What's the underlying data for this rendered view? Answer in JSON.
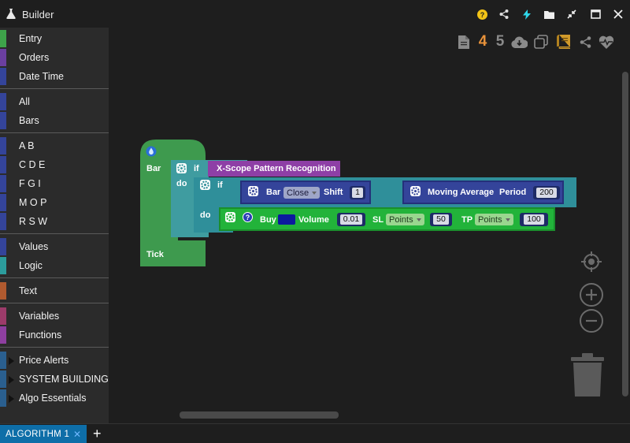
{
  "window": {
    "title": "Builder",
    "icons": [
      "help-icon",
      "share-icon",
      "bolt-icon",
      "folder-icon",
      "collapse-icon",
      "maximize-icon",
      "close-icon"
    ]
  },
  "sidebar": {
    "groups": [
      [
        {
          "label": "Entry",
          "color": "#3ea34a"
        },
        {
          "label": "Orders",
          "color": "#6b3fa0"
        },
        {
          "label": "Date Time",
          "color": "#34449a"
        }
      ],
      [
        {
          "label": "All",
          "color": "#34449a"
        },
        {
          "label": "Bars",
          "color": "#34449a"
        }
      ],
      [
        {
          "label": "A B",
          "color": "#34449a"
        },
        {
          "label": "C D E",
          "color": "#34449a"
        },
        {
          "label": "F G I",
          "color": "#34449a"
        },
        {
          "label": "M O P",
          "color": "#34449a"
        },
        {
          "label": "R S W",
          "color": "#34449a"
        }
      ],
      [
        {
          "label": "Values",
          "color": "#34449a"
        },
        {
          "label": "Logic",
          "color": "#2c9c9c"
        }
      ],
      [
        {
          "label": "Text",
          "color": "#b05a2f"
        }
      ],
      [
        {
          "label": "Variables",
          "color": "#9c3b6a"
        },
        {
          "label": "Functions",
          "color": "#8e3fa0"
        }
      ],
      [
        {
          "label": "Price Alerts",
          "color": "#2a5f8f",
          "arrow": true
        },
        {
          "label": "SYSTEM BUILDING",
          "color": "#2a5f8f",
          "arrow": true
        },
        {
          "label": "Algo Essentials",
          "color": "#2a5f8f",
          "arrow": true
        }
      ]
    ]
  },
  "toolbar": {
    "undo_count": "4",
    "redo_count": "5",
    "icons": [
      "document-icon",
      "download-cloud-icon",
      "copy-icon",
      "book-icon",
      "share-icon",
      "heartbeat-icon"
    ]
  },
  "blocks": {
    "entry": {
      "bar_label": "Bar",
      "do_label": "do",
      "tick_label": "Tick",
      "color": "#3e9a4e"
    },
    "outer_if": {
      "if_label": "if",
      "do_label": "do",
      "color": "#3f9ca0"
    },
    "pattern": {
      "label": "X-Scope Pattern Recognition",
      "color": "#8e3fa6"
    },
    "inner_if": {
      "if_label": "if",
      "do_label": "do",
      "color": "#2f8f9a"
    },
    "bar_value": {
      "label": "Bar",
      "field": "Close",
      "shift_label": "Shift",
      "shift": "1",
      "color": "#34449a"
    },
    "compare": {
      "op": ">",
      "color": "#2f8f9a"
    },
    "moving_average": {
      "label": "Moving Average",
      "period_label": "Period",
      "period": "200",
      "color": "#34449a"
    },
    "buy": {
      "label": "Buy",
      "color": "#22b33a",
      "color_swatch": "#0c1a9e",
      "volume_label": "Volume",
      "volume": "0.01",
      "sl_label": "SL",
      "sl_unit": "Points",
      "sl": "50",
      "tp_label": "TP",
      "tp_unit": "Points",
      "tp": "100"
    }
  },
  "tabs": {
    "active": "ALGORITHM 1",
    "add_label": "+",
    "close_label": "✕"
  }
}
